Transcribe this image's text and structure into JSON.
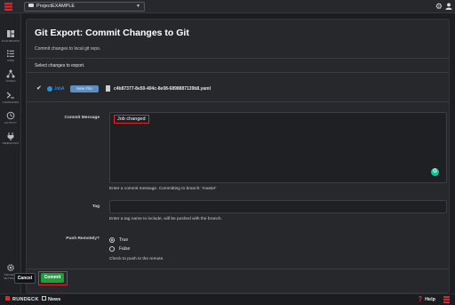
{
  "header": {
    "project": "ProjectEXAMPLE"
  },
  "sidebar": {
    "items": [
      {
        "label": "DASHBOARD",
        "icon": "dashboard-icon"
      },
      {
        "label": "JOBS",
        "icon": "jobs-list-icon"
      },
      {
        "label": "NODES",
        "icon": "nodes-icon"
      },
      {
        "label": "COMMANDS",
        "icon": "terminal-icon"
      },
      {
        "label": "ACTIVITY",
        "icon": "history-icon"
      },
      {
        "label": "WEBHOOKS",
        "icon": "webhook-icon"
      }
    ],
    "footer": {
      "label": "PROJECT SETTINGS",
      "icon": "gear-icon"
    }
  },
  "page": {
    "title": "Git Export: Commit Changes to Git",
    "subtitle": "Commit changes to local git repo.",
    "select_label": "Select changes to export.",
    "file": {
      "job_name": "JobA",
      "badge": "New File",
      "filename": "c4b87377-8e50-404c-8e08-6898887139b8.yaml"
    }
  },
  "form": {
    "commit_label": "Commit Message",
    "commit_value": "Job changed",
    "commit_help": "Enter a commit message. Committing to branch: 'master'",
    "tag_label": "Tag",
    "tag_help": "Enter a tag name to include, will be pushed with the branch.",
    "push_label": "Push Remotely?",
    "push_options": [
      "True",
      "False"
    ],
    "push_selected": "True",
    "push_help": "Check to push to the remote."
  },
  "buttons": {
    "cancel": "Cancel",
    "commit": "Commit"
  },
  "footer": {
    "brand": "RUNDECK",
    "news": "News",
    "help": "Help"
  },
  "colors": {
    "accent": "#e0242b",
    "commit": "#1f9d3a",
    "link": "#3ea0ef"
  }
}
